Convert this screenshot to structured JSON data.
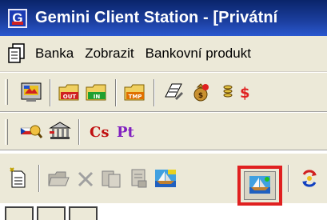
{
  "window": {
    "app_icon_letter": "G",
    "title": "Gemini Client Station - [Privátní"
  },
  "menubar": {
    "items": [
      {
        "label": "Banka"
      },
      {
        "label": "Zobrazit"
      },
      {
        "label": "Bankovní produkt"
      }
    ]
  },
  "toolbar1": {
    "buttons": [
      {
        "icon": "import-screen-icon"
      },
      {
        "icon": "out-folder-icon",
        "text": "OUT"
      },
      {
        "icon": "in-folder-icon",
        "text": "IN"
      },
      {
        "icon": "tmp-folder-icon",
        "text": "TMP"
      },
      {
        "icon": "edit-notebook-icon"
      },
      {
        "icon": "money-bag-icon"
      },
      {
        "icon": "coins-icon"
      }
    ]
  },
  "toolbar2": {
    "buttons": [
      {
        "icon": "flag-magnifier-icon"
      },
      {
        "icon": "bank-building-icon"
      },
      {
        "icon": "cs-currency-icon",
        "text": "Cs"
      },
      {
        "icon": "pt-icon",
        "text": "Pt"
      }
    ]
  },
  "toolbar3": {
    "buttons": [
      {
        "icon": "new-document-icon"
      },
      {
        "icon": "open-folder-icon"
      },
      {
        "icon": "delete-x-icon"
      },
      {
        "icon": "copy-document-icon"
      },
      {
        "icon": "properties-icon"
      },
      {
        "icon": "sailboat-icon"
      },
      {
        "icon": "sailboat-selected-icon"
      },
      {
        "icon": "refresh-arrows-icon"
      }
    ]
  },
  "colors": {
    "titlebar": "#0a246a",
    "toolbar_bg": "#ece9d8",
    "highlight": "#e02020"
  }
}
